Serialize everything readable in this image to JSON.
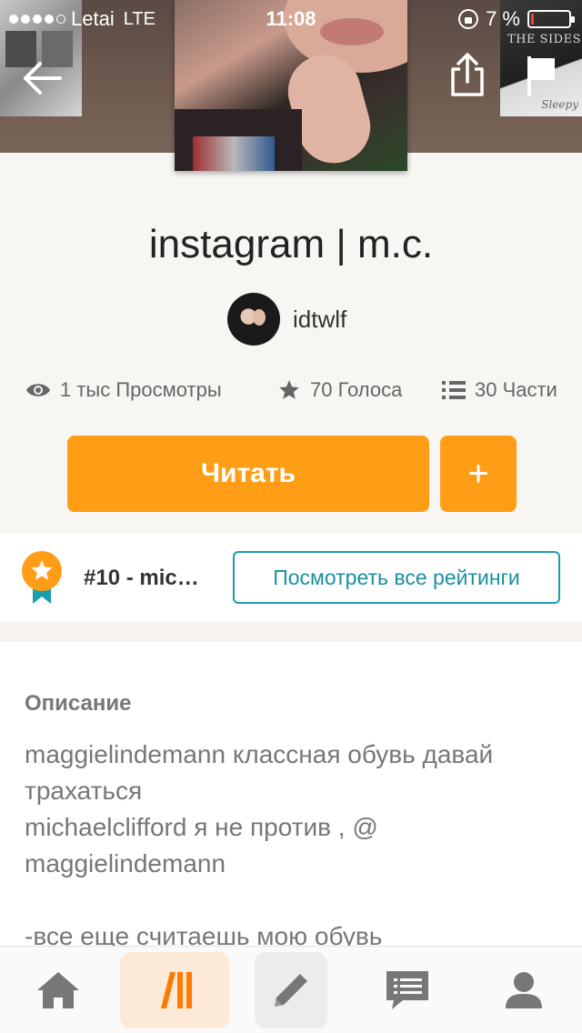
{
  "status_bar": {
    "signal_dots_filled": 4,
    "signal_dots_total": 5,
    "carrier": "Letai",
    "network": "LTE",
    "time": "11:08",
    "battery_percent": "7 %",
    "battery_level": 0.07
  },
  "header": {
    "background_left_label": "",
    "background_right_label": "THE SIDES OF",
    "background_right_sub": "Sleepy"
  },
  "story": {
    "title": "instagram | m.c.",
    "author": "idtwlf",
    "views": "1 тыс Просмотры",
    "votes": "70 Голоса",
    "parts": "30 Части"
  },
  "actions": {
    "read_label": "Читать",
    "add_label": "+"
  },
  "ranking": {
    "rank_text": "#10 - mic…",
    "view_all_label": "Посмотреть все рейтинги"
  },
  "description": {
    "heading": "Описание",
    "body": "maggielindemann классная обувь давай трахаться\nmichaelclifford я не против , @ maggielindemann\n\n-все еще считаешь мою обувь"
  },
  "colors": {
    "accent": "#ff9d17",
    "teal": "#1a9dae",
    "battery_low": "#ff3b30"
  },
  "nav": {
    "items": [
      "home-icon",
      "library-icon",
      "write-icon",
      "messages-icon",
      "profile-icon"
    ],
    "active": "library-icon"
  }
}
